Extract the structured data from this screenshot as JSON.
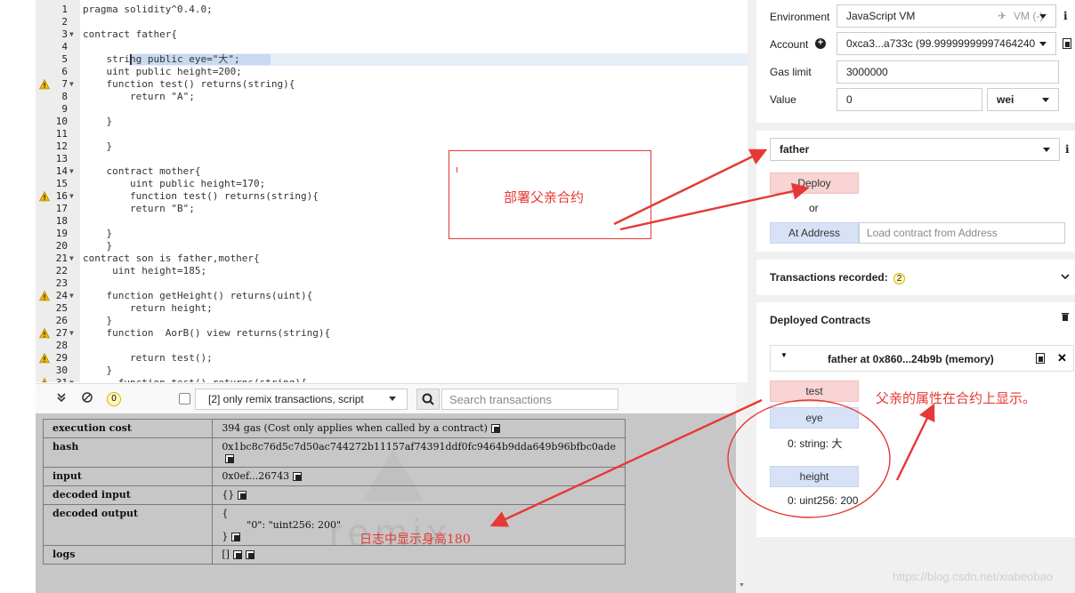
{
  "editor": {
    "lines": [
      {
        "n": "1",
        "text": "pragma solidity^0.4.0;",
        "fold": false,
        "warn": false
      },
      {
        "n": "2",
        "text": "",
        "fold": false,
        "warn": false
      },
      {
        "n": "3",
        "text": "contract father{",
        "fold": true,
        "warn": false
      },
      {
        "n": "4",
        "text": "",
        "fold": false,
        "warn": false
      },
      {
        "n": "5",
        "text": "    string public eye=\"大\";",
        "fold": false,
        "warn": false
      },
      {
        "n": "6",
        "text": "    uint public height=200;",
        "fold": false,
        "warn": false
      },
      {
        "n": "7",
        "text": "    function test() returns(string){",
        "fold": true,
        "warn": true
      },
      {
        "n": "8",
        "text": "        return \"A\";",
        "fold": false,
        "warn": false
      },
      {
        "n": "9",
        "text": "",
        "fold": false,
        "warn": false
      },
      {
        "n": "10",
        "text": "    }",
        "fold": false,
        "warn": false
      },
      {
        "n": "11",
        "text": "",
        "fold": false,
        "warn": false
      },
      {
        "n": "12",
        "text": "    }",
        "fold": false,
        "warn": false
      },
      {
        "n": "13",
        "text": "",
        "fold": false,
        "warn": false
      },
      {
        "n": "14",
        "text": "    contract mother{",
        "fold": true,
        "warn": false
      },
      {
        "n": "15",
        "text": "        uint public height=170;",
        "fold": false,
        "warn": false
      },
      {
        "n": "16",
        "text": "        function test() returns(string){",
        "fold": true,
        "warn": true
      },
      {
        "n": "17",
        "text": "        return \"B\";",
        "fold": false,
        "warn": false
      },
      {
        "n": "18",
        "text": "",
        "fold": false,
        "warn": false
      },
      {
        "n": "19",
        "text": "    }",
        "fold": false,
        "warn": false
      },
      {
        "n": "20",
        "text": "    }",
        "fold": false,
        "warn": false
      },
      {
        "n": "21",
        "text": "contract son is father,mother{",
        "fold": true,
        "warn": false
      },
      {
        "n": "22",
        "text": "     uint height=185;",
        "fold": false,
        "warn": false
      },
      {
        "n": "23",
        "text": "",
        "fold": false,
        "warn": false
      },
      {
        "n": "24",
        "text": "    function getHeight() returns(uint){",
        "fold": true,
        "warn": true
      },
      {
        "n": "25",
        "text": "        return height;",
        "fold": false,
        "warn": false
      },
      {
        "n": "26",
        "text": "    }",
        "fold": false,
        "warn": false
      },
      {
        "n": "27",
        "text": "    function  AorB() view returns(string){",
        "fold": true,
        "warn": true
      },
      {
        "n": "28",
        "text": "",
        "fold": false,
        "warn": false
      },
      {
        "n": "29",
        "text": "        return test();",
        "fold": false,
        "warn": true
      },
      {
        "n": "30",
        "text": "    }",
        "fold": false,
        "warn": false
      },
      {
        "n": "31",
        "text": "      function test() returns(string){",
        "fold": true,
        "warn": true
      }
    ]
  },
  "terminal": {
    "count": "0",
    "filter": "[2] only remix transactions, script",
    "search_placeholder": "Search transactions",
    "rows": [
      {
        "key": "execution cost",
        "value": "394 gas (Cost only applies when called by a contract)",
        "copy": true
      },
      {
        "key": "hash",
        "value": "0x1bc8c76d5c7d50ac744272b11157af74391ddf0fc9464b9dda649b96bfbc0ade",
        "copy": true
      },
      {
        "key": "input",
        "value": "0x0ef...26743",
        "copy": true
      },
      {
        "key": "decoded input",
        "value": "{}",
        "copy": true
      },
      {
        "key": "decoded output",
        "value": "{\n        \"0\": \"uint256: 200\"\n}",
        "copy": true
      },
      {
        "key": "logs",
        "value": "[]",
        "copy": true
      }
    ],
    "watermark": "remix"
  },
  "run": {
    "environment_label": "Environment",
    "environment_value": "JavaScript VM",
    "vm_label": "VM (-)",
    "account_label": "Account",
    "account_value": "0xca3...a733c (99.99999999997464240",
    "gas_limit_label": "Gas limit",
    "gas_limit_value": "3000000",
    "value_label": "Value",
    "value_value": "0",
    "value_unit": "wei",
    "contract_select": "father",
    "deploy_label": "Deploy",
    "or_label": "or",
    "at_address_label": "At Address",
    "at_address_placeholder": "Load contract from Address",
    "tx_recorded_label": "Transactions recorded:",
    "tx_recorded_count": "2",
    "deployed_title": "Deployed Contracts",
    "instance_label": "father at 0x860...24b9b (memory)",
    "functions": [
      {
        "name": "test",
        "color": "red",
        "result": ""
      },
      {
        "name": "eye",
        "color": "blue",
        "result": "0: string: 大"
      },
      {
        "name": "height",
        "color": "blue",
        "result": "0: uint256: 200"
      }
    ]
  },
  "annotations": {
    "deploy_note": "部署父亲合约",
    "property_note": "父亲的属性在合约上显示。",
    "log_note": "日志中显示身高180",
    "site_watermark": "https://blog.csdn.net/xiabeobao",
    "color": "#e53935"
  }
}
